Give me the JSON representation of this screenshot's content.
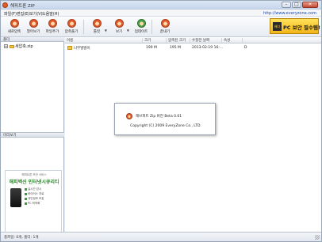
{
  "window": {
    "title": "해피트론 ZIP",
    "controls": {
      "minimize": "–",
      "maximize": "□",
      "close": "✕"
    }
  },
  "menu": {
    "items": [
      "파일(F)",
      "편집(E)",
      "보기(V)",
      "도움말(H)"
    ],
    "site_url": "http://www.everyzone.com"
  },
  "toolbar": {
    "tools": [
      {
        "label": "새로압축",
        "icon": "new-archive-icon"
      },
      {
        "label": "열어보기",
        "icon": "open-archive-icon"
      },
      {
        "label": "파일추가",
        "icon": "add-files-icon"
      },
      {
        "label": "압축풀기",
        "icon": "extract-icon"
      },
      {
        "label": "툴킷",
        "icon": "toolkit-icon",
        "dropdown": true
      },
      {
        "label": "보기",
        "icon": "view-icon",
        "dropdown": true
      },
      {
        "label": "업데이트",
        "icon": "update-icon"
      },
      {
        "label": "끝내기",
        "icon": "exit-icon"
      }
    ],
    "banner": {
      "logo": "배너",
      "text": "PC 보안 필수템!"
    }
  },
  "folder_pane": {
    "header": "폴더",
    "root": {
      "expand": "+",
      "label": "새압축.zip"
    }
  },
  "preview_pane": {
    "header": "미리보기"
  },
  "ad": {
    "top": "해피트론 보안 서비스",
    "headline": "해피백신 인터넷시큐리티",
    "lines": [
      "실시간 감시",
      "바이러스 치료",
      "개인정보 보호",
      "PC 최적화"
    ]
  },
  "file_list": {
    "columns": [
      "이름",
      "크기",
      "압축된 크기",
      "수정한 날짜",
      "속성"
    ],
    "rows": [
      {
        "name": "나무발발이",
        "size": "199 M",
        "packed": "195 M",
        "date": "2013-02-19 16:...",
        "attr": "D"
      }
    ]
  },
  "about": {
    "version": "해브피트 Zip 버전 Beta 0.61",
    "copyright": "Copyright (C) 2009 EveryZone Co., LTD."
  },
  "status": {
    "text": "총파일: 0개, 폴더: 1개"
  }
}
